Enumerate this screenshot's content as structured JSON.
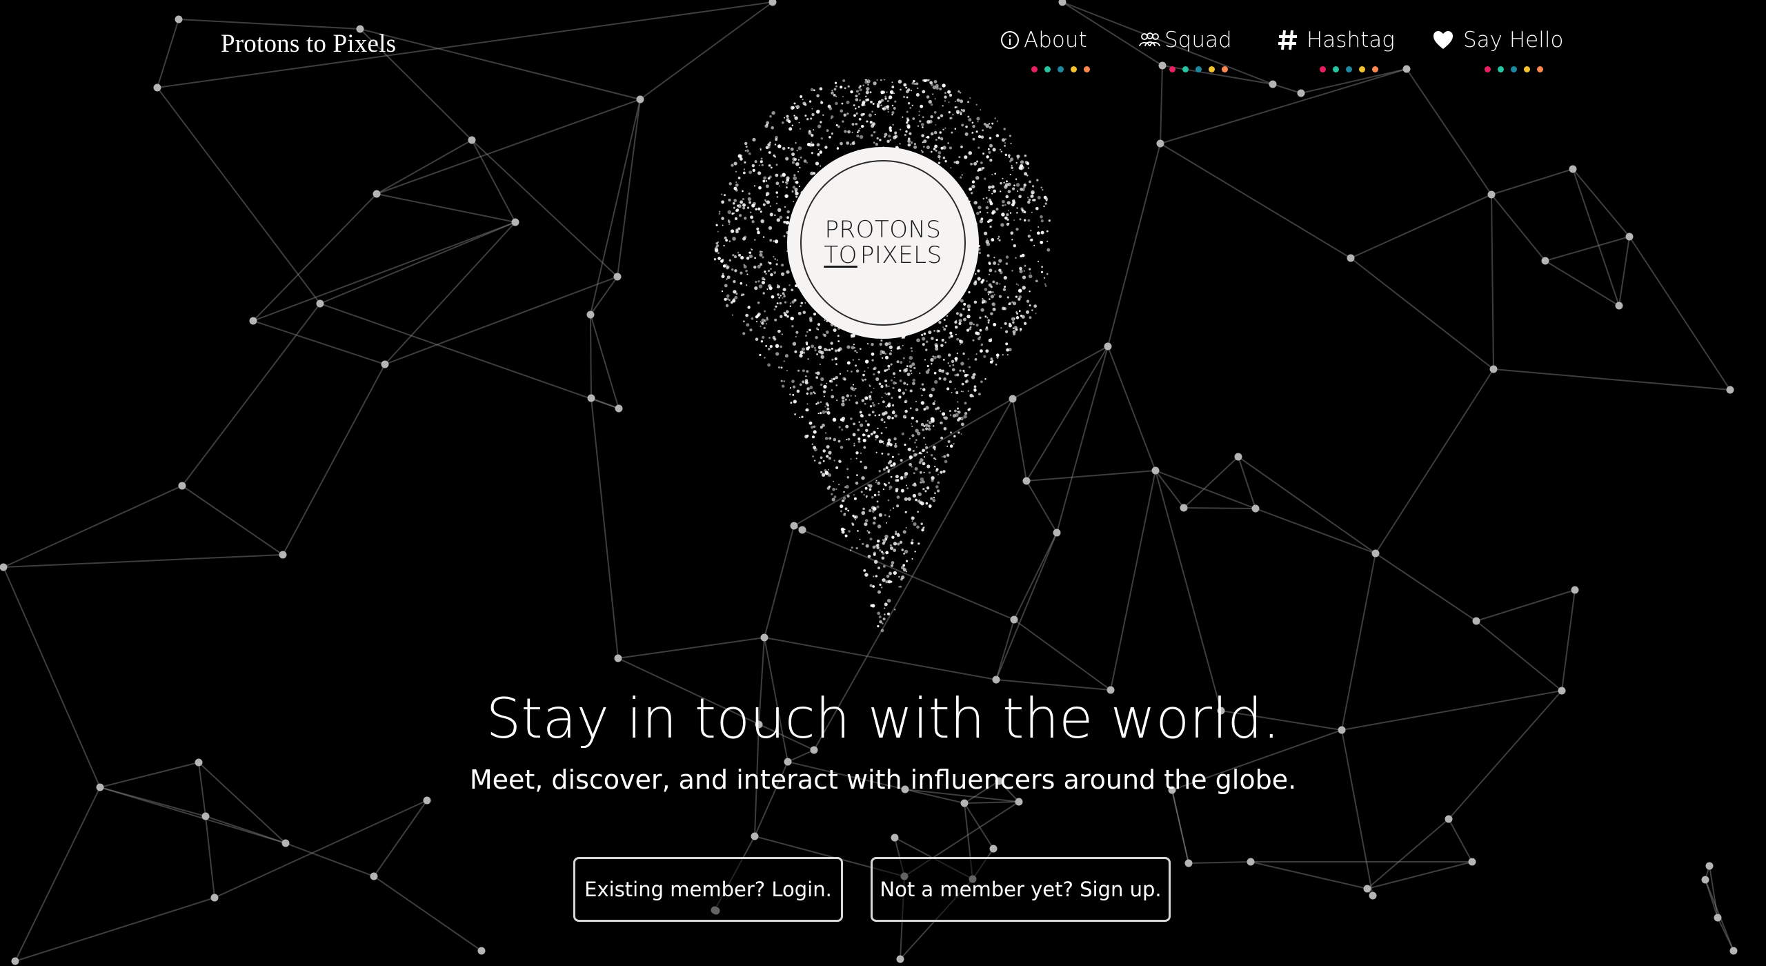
{
  "brand": {
    "title": "Protons to Pixels"
  },
  "nav": {
    "items": [
      {
        "label": "About",
        "icon": "info-icon",
        "dots": [
          "#e91e63",
          "#26c6a2",
          "#1e88a0",
          "#f4c430",
          "#ff8a50"
        ]
      },
      {
        "label": "Squad",
        "icon": "group-icon",
        "dots": [
          "#e91e63",
          "#26c6a2",
          "#1e88a0",
          "#f4c430",
          "#ff8a50"
        ]
      },
      {
        "label": "Hashtag",
        "icon": "hashtag-icon",
        "dots": [
          "#e91e63",
          "#26c6a2",
          "#1e88a0",
          "#f4c430",
          "#ff8a50"
        ]
      },
      {
        "label": "Say Hello",
        "icon": "heart-icon",
        "dots": [
          "#e91e63",
          "#26c6a2",
          "#1e88a0",
          "#f4c430",
          "#ff8a50"
        ]
      }
    ]
  },
  "logo": {
    "line1": "PROTONS",
    "to": "TO",
    "line2": "PIXELS"
  },
  "hero": {
    "headline": "Stay in touch with the world.",
    "subhead": "Meet, discover, and interact with influencers around the globe."
  },
  "buttons": {
    "login": "Existing member? Login.",
    "signup": "Not a member yet? Sign up."
  },
  "colors": {
    "background": "#000000",
    "text": "#ffffff",
    "network": "#8a8a8a",
    "logo_bg": "#f6f3f3"
  }
}
